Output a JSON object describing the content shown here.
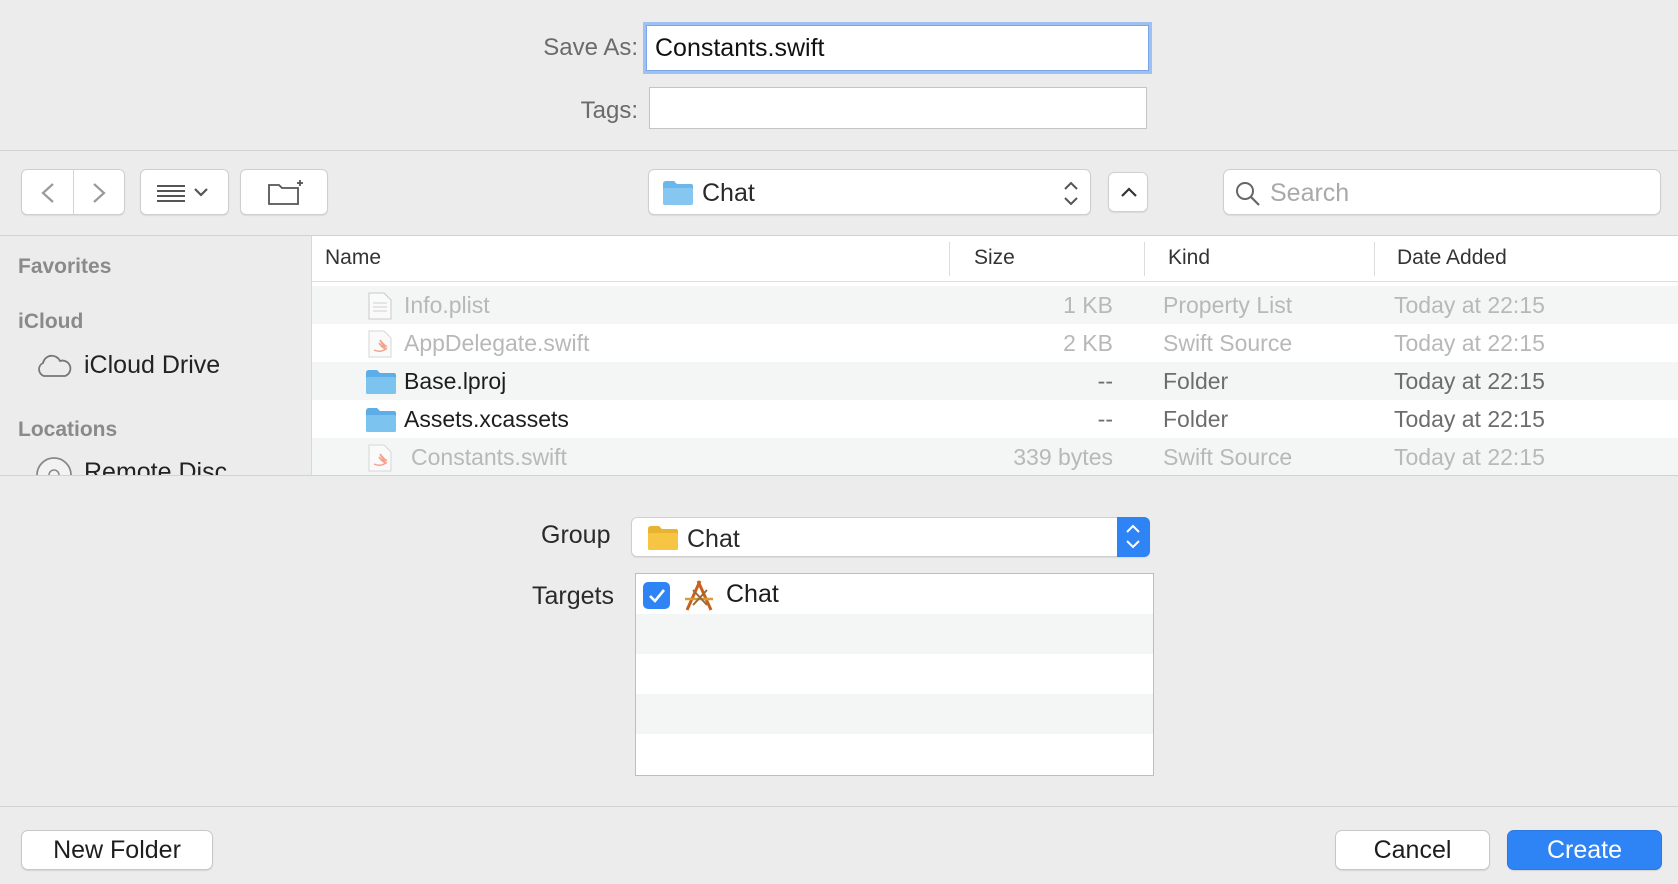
{
  "save_as": {
    "label": "Save As:",
    "value": "Constants.swift"
  },
  "tags": {
    "label": "Tags:",
    "value": ""
  },
  "toolbar": {
    "location": "Chat",
    "search_placeholder": "Search"
  },
  "sidebar": {
    "favorites_heading": "Favorites",
    "icloud_heading": "iCloud",
    "icloud_drive": "iCloud Drive",
    "locations_heading": "Locations",
    "remote_disc": "Remote Disc"
  },
  "columns": {
    "name": "Name",
    "size": "Size",
    "kind": "Kind",
    "date": "Date Added"
  },
  "files": [
    {
      "name": "Info.plist",
      "size": "1 KB",
      "kind": "Property List",
      "date": "Today at 22:15",
      "icon": "plist-file-icon",
      "enabled": false
    },
    {
      "name": "AppDelegate.swift",
      "size": "2 KB",
      "kind": "Swift Source",
      "date": "Today at 22:15",
      "icon": "swift-file-icon",
      "enabled": false
    },
    {
      "name": "Base.lproj",
      "size": "--",
      "kind": "Folder",
      "date": "Today at 22:15",
      "icon": "folder-icon",
      "enabled": true
    },
    {
      "name": "Assets.xcassets",
      "size": "--",
      "kind": "Folder",
      "date": "Today at 22:15",
      "icon": "folder-icon",
      "enabled": true
    },
    {
      "name": "Constants.swift",
      "size": "339 bytes",
      "kind": "Swift Source",
      "date": "Today at 22:15",
      "icon": "swift-file-icon",
      "enabled": false
    }
  ],
  "options": {
    "group_label": "Group",
    "group_value": "Chat",
    "targets_label": "Targets",
    "targets": [
      {
        "name": "Chat",
        "checked": true
      }
    ]
  },
  "buttons": {
    "new_folder": "New Folder",
    "cancel": "Cancel",
    "create": "Create"
  },
  "colors": {
    "accent": "#2f84f5",
    "folder_blue": "#6cb7ea",
    "folder_yellow": "#f6c544"
  }
}
